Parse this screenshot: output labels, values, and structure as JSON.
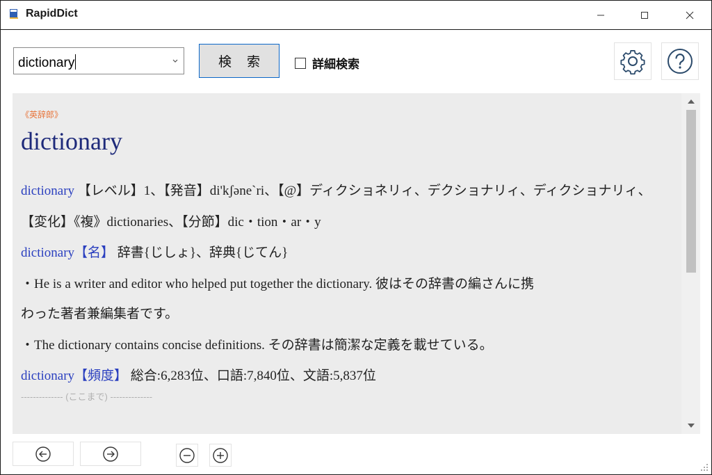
{
  "window": {
    "title": "RapidDict",
    "minimize_icon": "minimize-icon",
    "maximize_icon": "maximize-icon",
    "close_icon": "close-icon"
  },
  "toolbar": {
    "search_value": "dictionary",
    "search_button_label": "検 索",
    "advanced_search_label": "詳細検索",
    "advanced_search_checked": false,
    "settings_icon": "gear-icon",
    "help_icon": "question-icon"
  },
  "result": {
    "source": "《英辞郎》",
    "headword": "dictionary",
    "entries": [
      {
        "word": "dictionary",
        "tag": "",
        "text": "【レベル】1、【発音】di'kʃəne`ri、【@】ディクショネリィ、デクショナリィ、ディクショナリィ、"
      },
      {
        "word": "",
        "tag": "",
        "text": "【変化】《複》dictionaries、【分節】dic・tion・ar・y"
      },
      {
        "word": "dictionary",
        "tag": "【名】",
        "text": "辞書{じしょ}、辞典{じてん}"
      },
      {
        "word": "",
        "tag": "",
        "text": "・He is a writer and editor who helped put together the dictionary. 彼はその辞書の編さんに携"
      },
      {
        "word": "",
        "tag": "",
        "text": "わった著者兼編集者です。"
      },
      {
        "word": "",
        "tag": "",
        "text": "・The dictionary contains concise definitions. その辞書は簡潔な定義を載せている。"
      },
      {
        "word": "dictionary",
        "tag": "【頻度】",
        "text": "総合:6,283位、口語:7,840位、文語:5,837位"
      }
    ],
    "end_marker": "-------------- (ここまで) --------------"
  },
  "bottom": {
    "back_icon": "arrow-left-circle-icon",
    "forward_icon": "arrow-right-circle-icon",
    "zoom_out_icon": "minus-circle-icon",
    "zoom_in_icon": "plus-circle-icon"
  },
  "colors": {
    "accent_border": "#0a67c8",
    "link_blue": "#2a3fbf",
    "headword_navy": "#1e2a7a",
    "source_orange": "#e8743a",
    "content_bg": "#ececec"
  }
}
